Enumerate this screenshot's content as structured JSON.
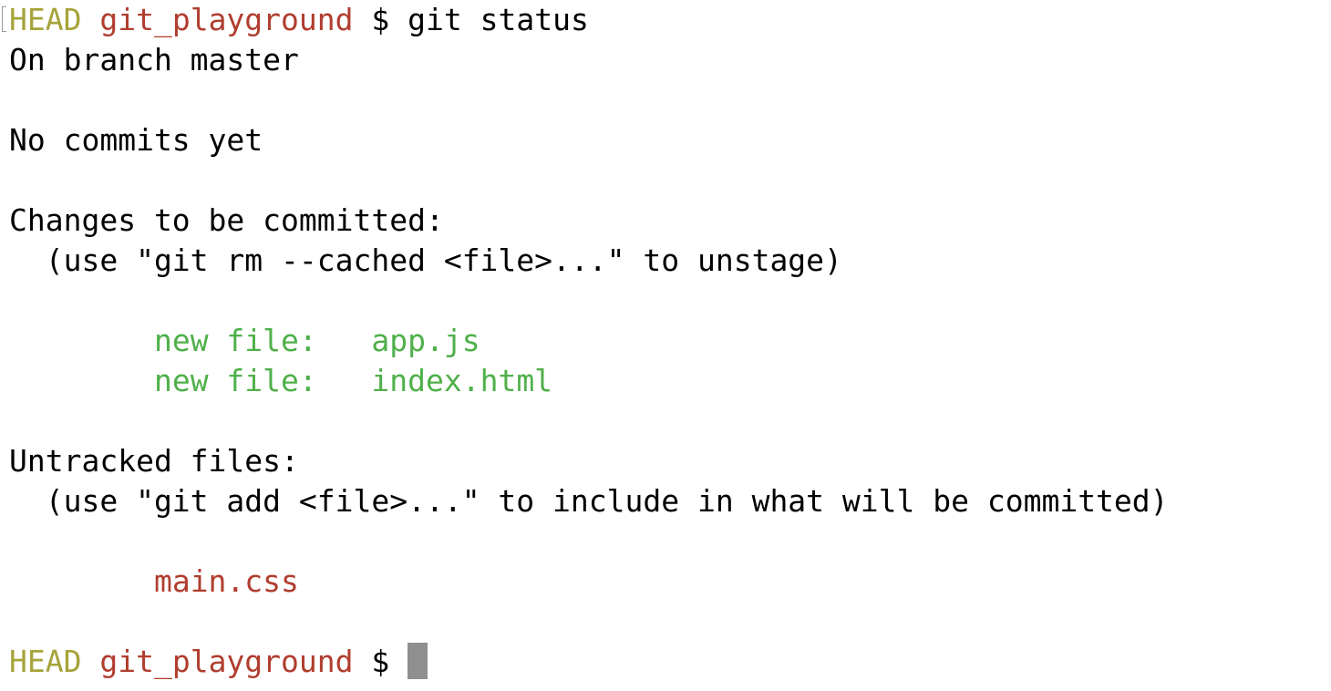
{
  "prompt": {
    "head": "HEAD",
    "dir": "git_playground",
    "symbol": "$"
  },
  "command": "git status",
  "lines": {
    "branch": "On branch master",
    "no_commits": "No commits yet",
    "changes_header": "Changes to be committed:",
    "changes_hint": "  (use \"git rm --cached <file>...\" to unstage)",
    "untracked_header": "Untracked files:",
    "untracked_hint": "  (use \"git add <file>...\" to include in what will be committed)"
  },
  "staged_files": [
    {
      "status": "new file:",
      "name": "app.js"
    },
    {
      "status": "new file:",
      "name": "index.html"
    }
  ],
  "untracked_files": [
    {
      "name": "main.css"
    }
  ],
  "colors": {
    "head": "#a6a33a",
    "dir": "#b03d2e",
    "staged": "#4fb04a",
    "untracked": "#b03d2e",
    "cursor": "#8f8f8f"
  }
}
